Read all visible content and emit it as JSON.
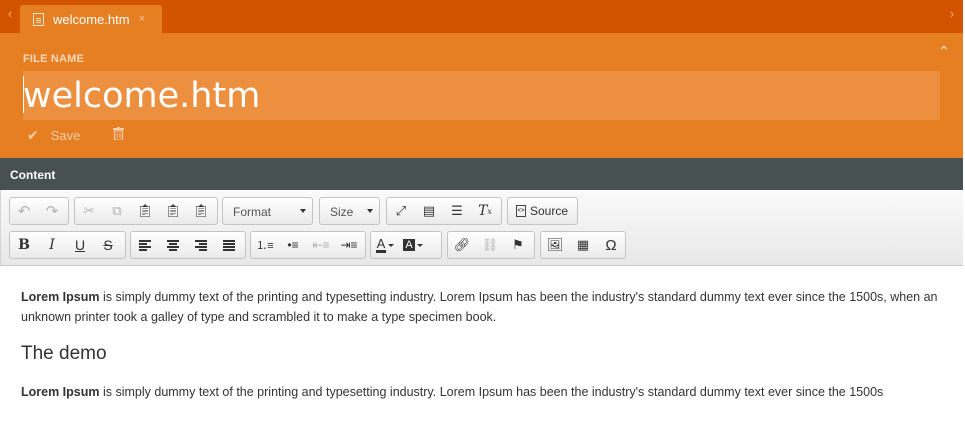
{
  "tab": {
    "label": "welcome.htm",
    "close": "×"
  },
  "nav": {
    "left_arrow": "‹",
    "right_arrow": "›",
    "collapse": "⌃"
  },
  "file": {
    "label": "FILE NAME",
    "value": "welcome.htm",
    "save_label": "Save"
  },
  "content_section": {
    "title": "Content"
  },
  "toolbar": {
    "format_label": "Format",
    "size_label": "Size",
    "source_label": "Source"
  },
  "editor": {
    "p1_bold": "Lorem Ipsum",
    "p1_text": " is simply dummy text of the printing and typesetting industry. Lorem Ipsum has been the industry's standard dummy text ever since the 1500s, when an unknown printer took a galley of type and scrambled it to make a type specimen book.",
    "heading": "The demo",
    "p2_bold": "Lorem Ipsum",
    "p2_text": " is simply dummy text of the printing and typesetting industry. Lorem Ipsum has been the industry's standard dummy text ever since the 1500s"
  },
  "colors": {
    "tab_bar": "#d35400",
    "header": "#e67e22",
    "content_bar": "#475152"
  }
}
